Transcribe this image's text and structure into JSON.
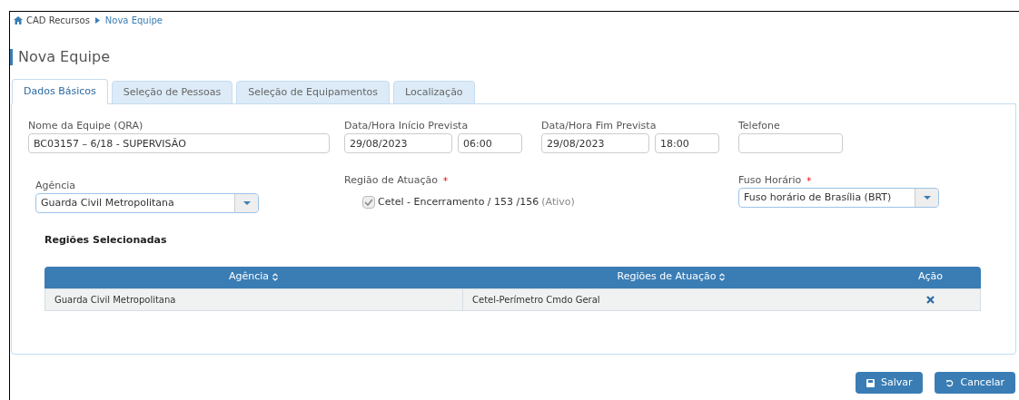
{
  "breadcrumb": [
    {
      "label": "CAD Recursos",
      "current": false
    },
    {
      "label": "Nova Equipe",
      "current": true
    }
  ],
  "title": "Nova Equipe",
  "tabs": [
    {
      "label": "Dados Básicos",
      "selected": true
    },
    {
      "label": "Seleção de Pessoas",
      "selected": false
    },
    {
      "label": "Seleção de Equipamentos",
      "selected": false
    },
    {
      "label": "Localização",
      "selected": false
    }
  ],
  "form": {
    "team_name": {
      "label": "Nome da Equipe (QRA)",
      "value": "BC03157 – 6/18 - SUPERVISÃO"
    },
    "start": {
      "label": "Data/Hora Início Prevista",
      "date": "29/08/2023",
      "time": "06:00"
    },
    "end": {
      "label": "Data/Hora Fim Prevista",
      "date": "29/08/2023",
      "time": "18:00"
    },
    "phone": {
      "label": "Telefone"
    },
    "agency": {
      "label": "Agência",
      "value": "Guarda Civil Metropolitana"
    },
    "region": {
      "label": "Região de Atuação",
      "required_mark": "*",
      "options": [
        {
          "label": "Cetel - Encerramento / 153 /156",
          "status": "(Ativo)",
          "checked": true
        }
      ]
    },
    "timezone": {
      "label": "Fuso Horário",
      "required_mark": "*",
      "value": "Fuso horário de Brasília (BRT)"
    }
  },
  "selected_regions": {
    "title": "Regiões Selecionadas",
    "columns": [
      "Agência",
      "Regiões de Atuação",
      "Ação"
    ],
    "rows": [
      {
        "agency": "Guarda Civil Metropolitana",
        "region": "Cetel-Perímetro Cmdo Geral"
      }
    ]
  },
  "buttons": [
    {
      "kind": "save",
      "label": "Salvar"
    },
    {
      "kind": "cancel",
      "label": "Cancelar"
    }
  ]
}
